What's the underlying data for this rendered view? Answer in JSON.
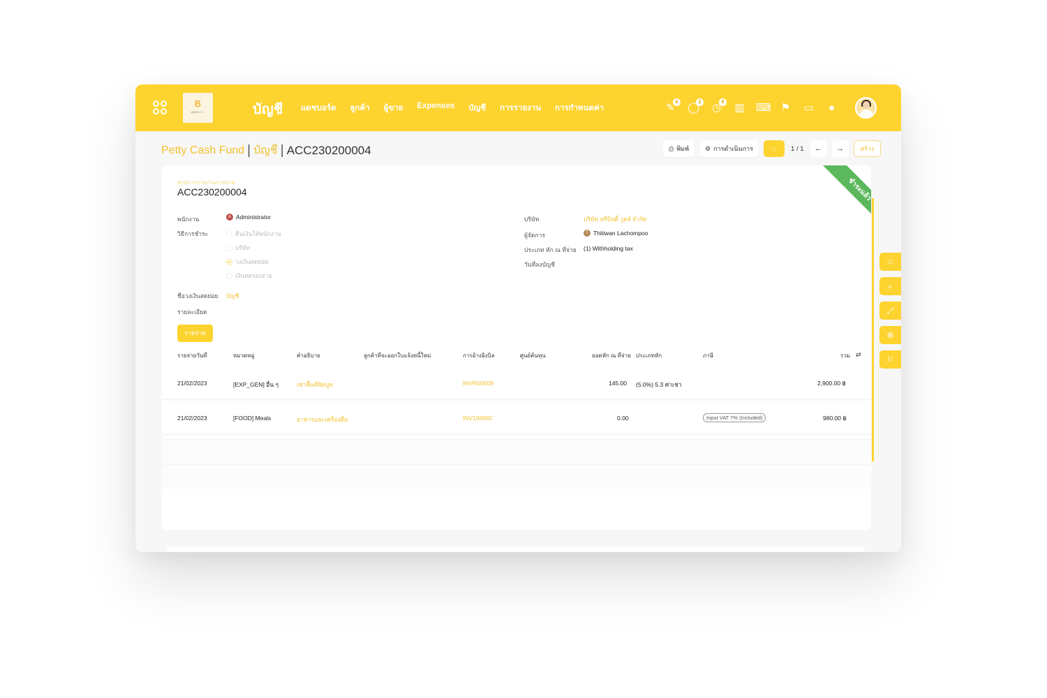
{
  "navbar": {
    "app_title": "บัญชี",
    "logo_letter": "B",
    "logo_text": "BEECY",
    "menu": [
      "แดชบอร์ด",
      "ลูกค้า",
      "ผู้ขาย",
      "Expenses",
      "บัญชี",
      "การรายงาน",
      "การกำหนดค่า"
    ],
    "icons": [
      {
        "name": "activity-icon",
        "glyph": "✎",
        "badge": "6"
      },
      {
        "name": "chat-icon",
        "glyph": "◯",
        "badge": "2"
      },
      {
        "name": "timer-icon",
        "glyph": "◷",
        "badge": "9"
      },
      {
        "name": "chart-icon",
        "glyph": "▥",
        "badge": ""
      },
      {
        "name": "code-icon",
        "glyph": "⌨",
        "badge": ""
      },
      {
        "name": "brush-icon",
        "glyph": "⚑",
        "badge": ""
      },
      {
        "name": "note-icon",
        "glyph": "▭",
        "badge": ""
      },
      {
        "name": "bulb-icon",
        "glyph": "●",
        "badge": ""
      }
    ]
  },
  "breadcrumb": {
    "parent": "Petty Cash Fund",
    "section": "บัญชี",
    "current": "ACC230200004"
  },
  "actions": {
    "print": "พิมพ์",
    "action": "การดำเนินการ",
    "pager": "1 / 1",
    "create": "สร้าง"
  },
  "form": {
    "ribbon": "ชำระแล้ว",
    "subtitle": "สรุปการรายงานรายจ่าย",
    "doc_no": "ACC230200004",
    "employee_label": "พนักงาน",
    "employee": "Administrator",
    "employee_initial": "A",
    "payment_label": "วิธีการชำระ",
    "payment_options": [
      "คืนเงินให้พนักงาน",
      "บริษัท",
      "วงเงินสดย่อย",
      "เงินทดรองจ่าย"
    ],
    "payment_selected": 2,
    "petty_label": "ชื่อวงเงินสดย่อย",
    "petty_value": "บัญชี",
    "detail_label": "รายละเอียด",
    "company_label": "บริษัท",
    "company": "บริษัท ทรีบิลดิ์ วูดส์ จำกัด",
    "manager_label": "ผู้จัดการ",
    "manager": "Thitiwan Lachompoo",
    "manager_initial": "T",
    "wht_label": "ประเภท หัก ณ ที่จ่าย",
    "wht": "(1) Withholding tax",
    "date_label": "วันที่ลงบัญชี",
    "tab": "รายจ่าย"
  },
  "table": {
    "headers": [
      "รายจ่ายวันที่",
      "หมวดหมู่",
      "คำอธิบาย",
      "ลูกค้าที่จะออกใบแจ้งหนี้ใหม่",
      "การอ้างอิงบิล",
      "ศูนย์ต้นทุน",
      "ยอดหัก ณ ที่จ่าย",
      "ประเภทหัก",
      "ภาษี",
      "รวม"
    ],
    "rows": [
      {
        "date": "21/02/2023",
        "category": "[EXP_GEN] อื่น ๆ",
        "desc": "เช่าพื้นที่จัดบูท",
        "ref": "INVR00009",
        "wht_amount": "145.00",
        "wht_type": "(5.0%) 5.3 ค่าเช่า",
        "tax": "",
        "total": "2,900.00 ฿"
      },
      {
        "date": "21/02/2023",
        "category": "[FOOD] Meals",
        "desc": "อาหารและเครื่องดื่ม",
        "ref": "INV198992",
        "wht_amount": "0.00",
        "wht_type": "",
        "tax": "Input VAT 7% (Included)",
        "total": "980.00 ฿"
      }
    ]
  },
  "side_tools": [
    "star-icon",
    "search-icon",
    "expand-icon",
    "zoom-icon",
    "bookmark-icon"
  ],
  "colors": {
    "brand": "#fdd32f",
    "ribbon": "#5bb85c",
    "link": "#f2c12e"
  }
}
